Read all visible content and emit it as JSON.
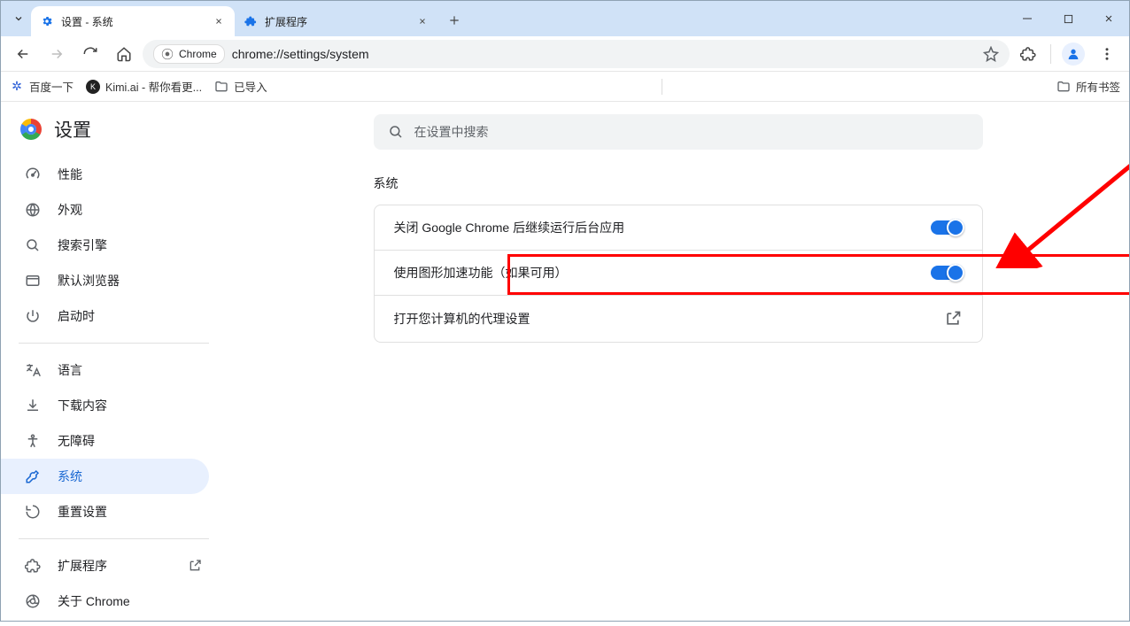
{
  "tabs": {
    "items": [
      {
        "title": "设置 - 系统",
        "active": true,
        "favicon": "gear"
      },
      {
        "title": "扩展程序",
        "active": false,
        "favicon": "puzzle"
      }
    ]
  },
  "toolbar": {
    "site_chip": "Chrome",
    "url": "chrome://settings/system"
  },
  "bookmarks": {
    "items": [
      {
        "label": "百度一下",
        "icon": "paw"
      },
      {
        "label": "Kimi.ai - 帮你看更...",
        "icon": "kimi"
      },
      {
        "label": "已导入",
        "icon": "folder"
      }
    ],
    "all_label": "所有书签"
  },
  "settings": {
    "title": "设置",
    "search_placeholder": "在设置中搜索",
    "nav_groups": [
      [
        {
          "id": "performance",
          "label": "性能",
          "icon": "speed"
        },
        {
          "id": "appearance",
          "label": "外观",
          "icon": "globe"
        },
        {
          "id": "search",
          "label": "搜索引擎",
          "icon": "search"
        },
        {
          "id": "default",
          "label": "默认浏览器",
          "icon": "browser"
        },
        {
          "id": "startup",
          "label": "启动时",
          "icon": "power"
        }
      ],
      [
        {
          "id": "language",
          "label": "语言",
          "icon": "translate"
        },
        {
          "id": "downloads",
          "label": "下载内容",
          "icon": "download"
        },
        {
          "id": "a11y",
          "label": "无障碍",
          "icon": "a11y"
        },
        {
          "id": "system",
          "label": "系统",
          "icon": "wrench",
          "active": true
        },
        {
          "id": "reset",
          "label": "重置设置",
          "icon": "reset"
        }
      ],
      [
        {
          "id": "extensions",
          "label": "扩展程序",
          "icon": "puzzle",
          "external": true
        },
        {
          "id": "about",
          "label": "关于 Chrome",
          "icon": "chrome"
        }
      ]
    ],
    "section_heading": "系统",
    "rows": [
      {
        "label": "关闭 Google Chrome 后继续运行后台应用",
        "control": "toggle",
        "value": true
      },
      {
        "label": "使用图形加速功能（如果可用）",
        "control": "toggle",
        "value": true,
        "highlighted": true
      },
      {
        "label": "打开您计算机的代理设置",
        "control": "link"
      }
    ]
  },
  "annotation": {
    "arrow_color": "#ff0000",
    "box_color": "#ff0000"
  }
}
